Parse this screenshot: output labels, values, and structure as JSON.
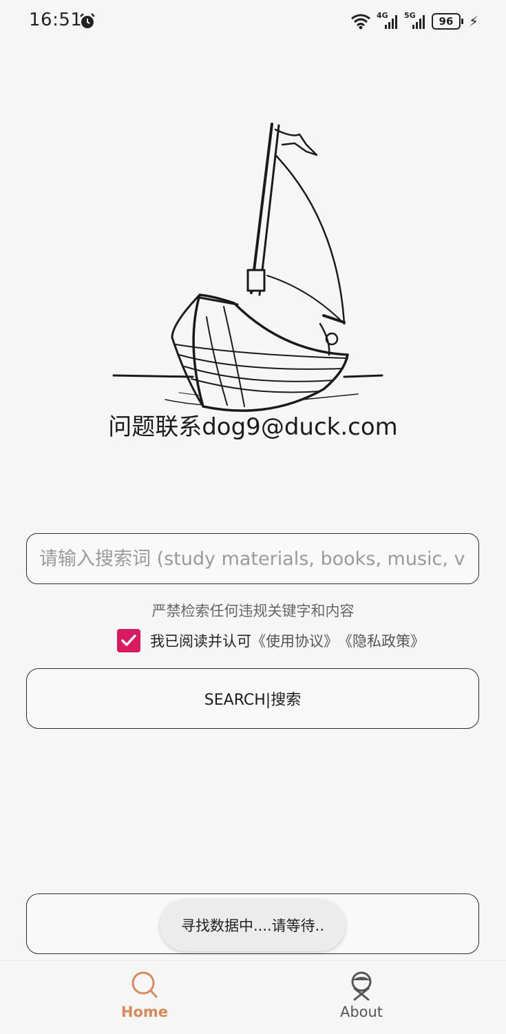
{
  "status_bar": {
    "time": "16:51",
    "network_1": "4G",
    "network_2": "5G",
    "battery": "96",
    "icons": [
      "alarm-icon",
      "wifi-icon",
      "signal-icon",
      "battery-icon",
      "charging-bolt-icon"
    ]
  },
  "logo": {
    "caption": "问题联系dog9@duck.com"
  },
  "search": {
    "placeholder": "请输入搜索词 (study materials, books, music, video)"
  },
  "warning": "严禁检索任何违规关键字和内容",
  "agreement": {
    "checked": true,
    "text": "我已阅读并认可",
    "links": [
      "《使用协议》",
      "《隐私政策》"
    ]
  },
  "search_button": "SEARCH|搜索",
  "toast": "寻找数据中....请等待..",
  "bottom_nav": {
    "home_label": "Home",
    "about_label": "About"
  },
  "colors": {
    "accent": "#d9895a",
    "checkbox": "#d81b60",
    "background": "#f6f6f6"
  }
}
